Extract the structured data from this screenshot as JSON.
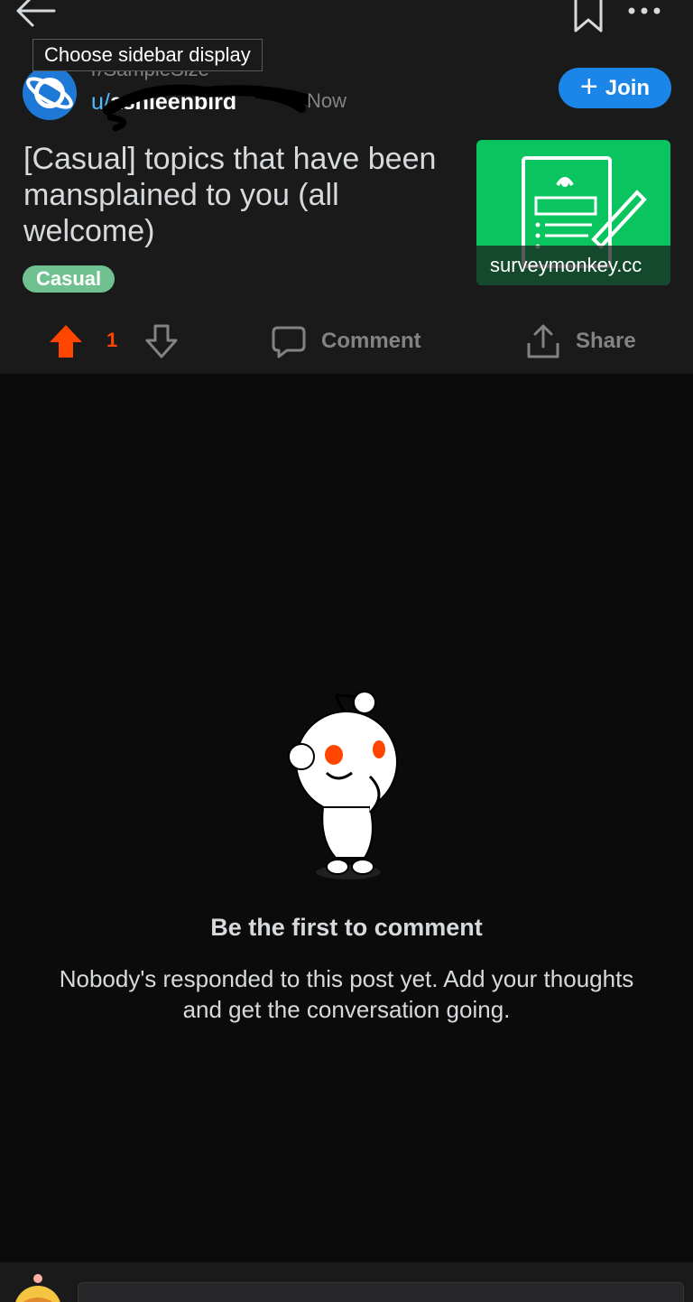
{
  "tooltip": {
    "text": "Choose sidebar display"
  },
  "post": {
    "subreddit": "r/SampleSize",
    "author_prefix": "u/",
    "author_name": "ashleenbird",
    "time": "Now",
    "title": "[Casual] topics that have been mansplained to you (all welcome)",
    "flair": "Casual",
    "thumbnail_domain": "surveymonkey.cc",
    "join_label": "Join",
    "vote_count": "1",
    "comment_label": "Comment",
    "share_label": "Share"
  },
  "empty_state": {
    "title": "Be the first to comment",
    "body": "Nobody's responded to this post yet. Add your thoughts and get the conversation going."
  },
  "colors": {
    "background": "#0b0b0c",
    "post_background": "#1a1a1b",
    "upvote": "#ff4500",
    "join_button": "#1c85e8",
    "flair": "#6fc18f",
    "thumbnail": "#0ac55f",
    "muted_text": "#818384"
  },
  "icons": {
    "back": "arrow-left-icon",
    "bookmark": "bookmark-icon",
    "more": "more-horizontal-icon",
    "upvote": "upvote-arrow-icon",
    "downvote": "downvote-arrow-icon",
    "comment": "speech-bubble-icon",
    "share": "share-icon"
  }
}
